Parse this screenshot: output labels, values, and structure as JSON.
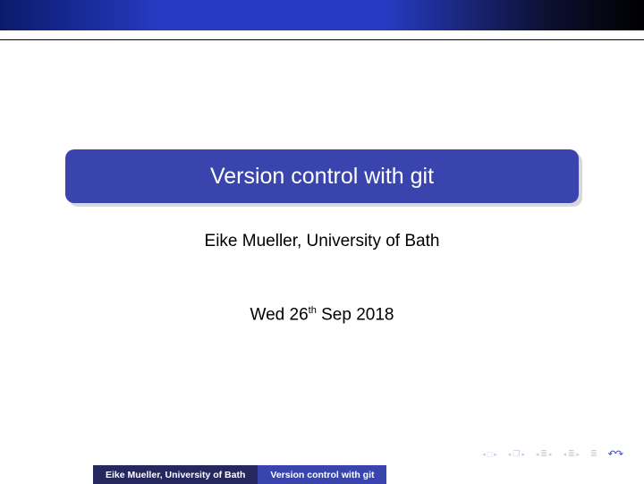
{
  "title": "Version control with git",
  "author": "Eike Mueller, University of Bath",
  "date_prefix": "Wed 26",
  "date_sup": "th",
  "date_suffix": " Sep 2018",
  "footer": {
    "author": "Eike Mueller, University of Bath",
    "title": "Version control with git"
  },
  "nav": {
    "loop": "↶↷"
  }
}
